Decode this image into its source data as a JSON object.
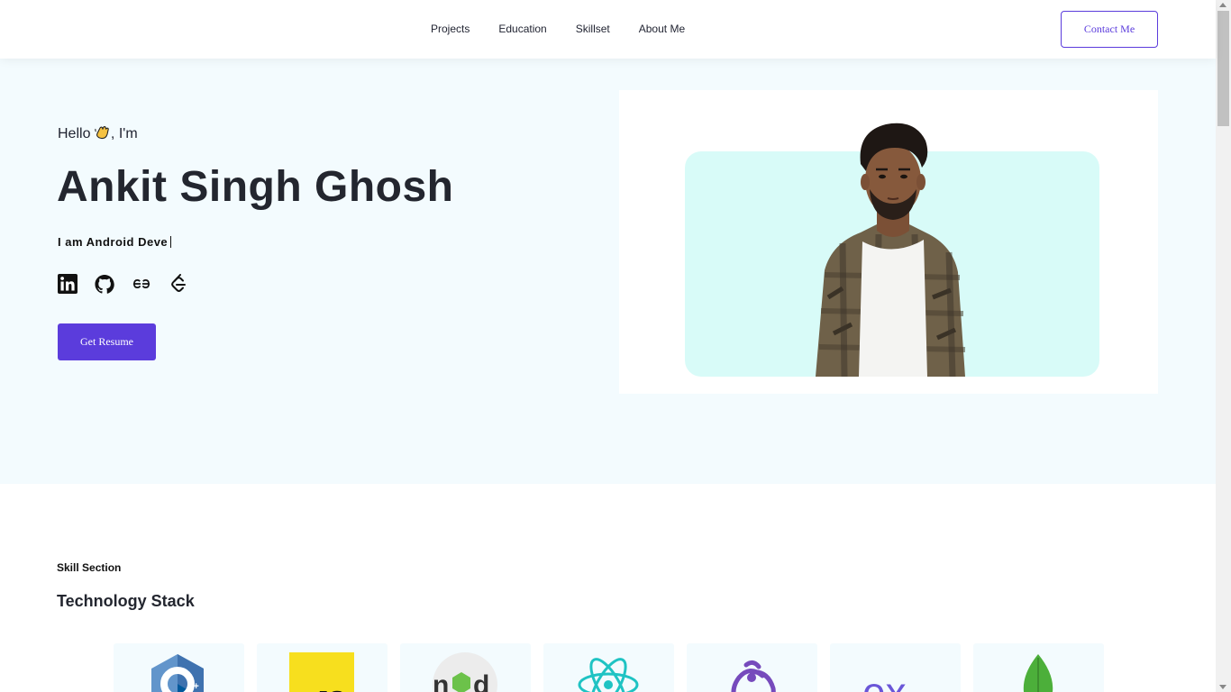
{
  "nav": {
    "items": [
      {
        "label": "Projects"
      },
      {
        "label": "Education"
      },
      {
        "label": "Skillset"
      },
      {
        "label": "About Me"
      }
    ],
    "contact_label": "Contact Me"
  },
  "hero": {
    "greeting_before": "Hello",
    "greeting_after": ", I'm",
    "name": "Ankit Singh Ghosh",
    "role_text": "I am Android Deve",
    "resume_label": "Get Resume",
    "socials": [
      {
        "icon": "linkedin-icon"
      },
      {
        "icon": "github-icon"
      },
      {
        "icon": "geeksforgeeks-icon"
      },
      {
        "icon": "leetcode-icon"
      }
    ]
  },
  "skills": {
    "eyebrow": "Skill Section",
    "title": "Technology Stack",
    "tech": [
      {
        "icon": "cpp-icon"
      },
      {
        "icon": "javascript-icon"
      },
      {
        "icon": "nodejs-icon"
      },
      {
        "icon": "react-icon"
      },
      {
        "icon": "redux-icon"
      },
      {
        "icon": "express-icon"
      },
      {
        "icon": "mongodb-icon"
      }
    ]
  },
  "colors": {
    "accent": "#5b3cdc",
    "hero_bg": "#f3fbfe",
    "photo_bg": "#d8fbf8"
  }
}
